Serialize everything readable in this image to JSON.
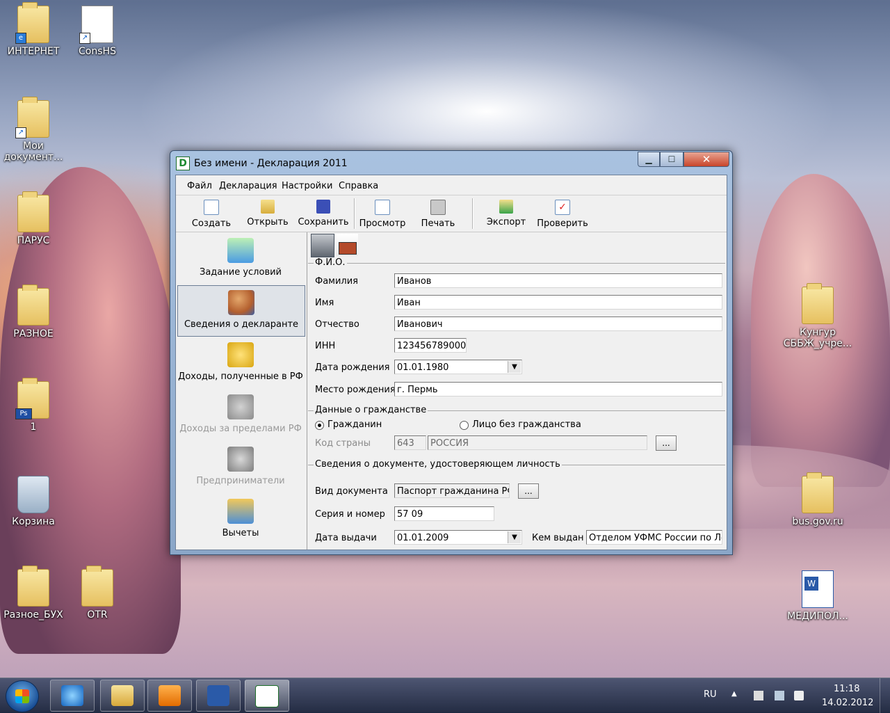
{
  "desktop": {
    "icons_left": [
      "ИНТЕРНЕТ",
      "ConsHS",
      "Мои документ...",
      "ПАРУС",
      "РАЗНОЕ",
      "1",
      "Корзина",
      "Разное_БУХ",
      "OTR"
    ],
    "icons_right": [
      "Кунгур СББЖ_учре...",
      "bus.gov.ru",
      "МЕДИПОЛ..."
    ]
  },
  "window": {
    "title": "Без имени - Декларация 2011",
    "menu": [
      "Файл",
      "Декларация",
      "Настройки",
      "Справка"
    ],
    "toolbar": [
      "Создать",
      "Открыть",
      "Сохранить",
      "Просмотр",
      "Печать",
      "Экспорт",
      "Проверить"
    ],
    "sidebar": [
      "Задание условий",
      "Сведения о декларанте",
      "Доходы, полученные в РФ",
      "Доходы за пределами РФ",
      "Предприниматели",
      "Вычеты"
    ]
  },
  "form": {
    "fio_group": "Ф.И.О.",
    "surname_label": "Фамилия",
    "surname": "Иванов",
    "name_label": "Имя",
    "name": "Иван",
    "patronymic_label": "Отчество",
    "patronymic": "Иванович",
    "inn_label": "ИНН",
    "inn": "123456789000",
    "birthdate_label": "Дата рождения",
    "birthdate": "01.01.1980",
    "birthplace_label": "Место рождения",
    "birthplace": "г. Пермь",
    "citizenship_group": "Данные о гражданстве",
    "citizen_label": "Гражданин",
    "stateless_label": "Лицо без гражданства",
    "country_code_label": "Код страны",
    "country_code": "643",
    "country_name": "РОССИЯ",
    "doc_group": "Сведения о документе, удостоверяющем личность",
    "doc_type_label": "Вид документа",
    "doc_type": "Паспорт гражданина РФ",
    "series_label": "Серия и номер",
    "series": "57 09",
    "issue_date_label": "Дата выдачи",
    "issue_date": "01.01.2009",
    "issued_by_label": "Кем выдан",
    "issued_by": "Отделом УФМС России по Ле",
    "ellipsis": "..."
  },
  "taskbar": {
    "lang": "RU",
    "time": "11:18",
    "date": "14.02.2012"
  },
  "glyphs": {
    "close": "✕",
    "minimize": "▁",
    "maximize": "☐",
    "dropdown": "▼",
    "arrow": "▲"
  }
}
